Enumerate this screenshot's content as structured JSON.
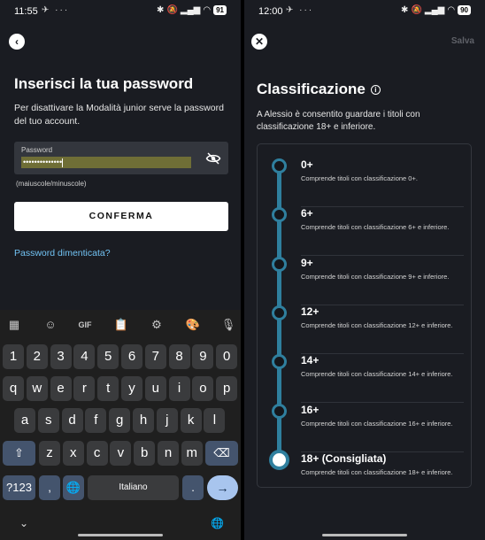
{
  "left": {
    "status": {
      "time": "11:55",
      "battery": "91"
    },
    "title": "Inserisci la tua password",
    "description": "Per disattivare la Modalità junior serve la password del tuo account.",
    "password": {
      "label": "Password",
      "value": "••••••••••••••"
    },
    "hint": "(maiuscole/minuscole)",
    "confirm_label": "CONFERMA",
    "forgot_label": "Password dimenticata?",
    "keyboard": {
      "toolbar": [
        "grid",
        "sticker",
        "GIF",
        "clipboard",
        "settings",
        "palette",
        "mic"
      ],
      "gif_label": "GIF",
      "row1": [
        "1",
        "2",
        "3",
        "4",
        "5",
        "6",
        "7",
        "8",
        "9",
        "0"
      ],
      "row2": [
        "q",
        "w",
        "e",
        "r",
        "t",
        "y",
        "u",
        "i",
        "o",
        "p"
      ],
      "row3": [
        "a",
        "s",
        "d",
        "f",
        "g",
        "h",
        "j",
        "k",
        "l"
      ],
      "row4": [
        "z",
        "x",
        "c",
        "v",
        "b",
        "n",
        "m"
      ],
      "symbols_label": "?123",
      "comma": ",",
      "space_label": "Italiano",
      "period": "."
    }
  },
  "right": {
    "status": {
      "time": "12:00",
      "battery": "90"
    },
    "save_label": "Salva",
    "title": "Classificazione",
    "description": "A Alessio è consentito guardare i titoli con classificazione 18+ e inferiore.",
    "ratings": [
      {
        "label": "0+",
        "desc": "Comprende titoli con classificazione 0+."
      },
      {
        "label": "6+",
        "desc": "Comprende titoli con classificazione 6+ e inferiore."
      },
      {
        "label": "9+",
        "desc": "Comprende titoli con classificazione 9+ e inferiore."
      },
      {
        "label": "12+",
        "desc": "Comprende titoli con classificazione 12+ e inferiore."
      },
      {
        "label": "14+",
        "desc": "Comprende titoli con classificazione 14+ e inferiore."
      },
      {
        "label": "16+",
        "desc": "Comprende titoli con classificazione 16+ e inferiore."
      },
      {
        "label": "18+ (Consigliata)",
        "desc": "Comprende titoli con classificazione 18+ e inferiore."
      }
    ],
    "selected_rating_index": 6
  },
  "colors": {
    "accent": "#2f7f9e",
    "link": "#72c3f4",
    "background": "#1a1c22",
    "enter_key": "#a8c5ee"
  }
}
